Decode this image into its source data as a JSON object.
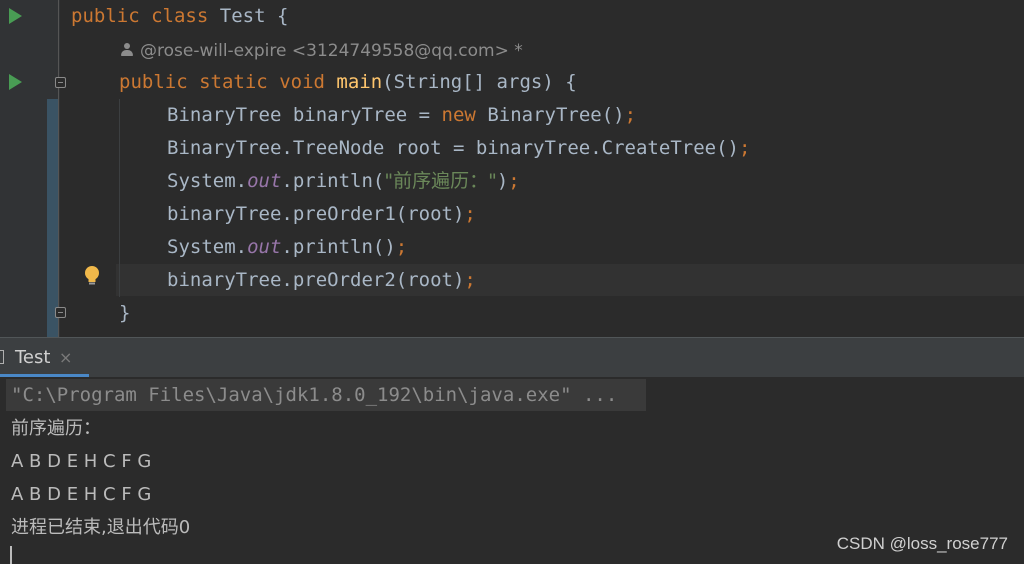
{
  "editor": {
    "line1": {
      "kw1": "public",
      "kw2": "class",
      "name": "Test",
      "brace": "{"
    },
    "author_hint": "@rose-will-expire <3124749558@qq.com> *",
    "line2": {
      "kw1": "public",
      "kw2": "static",
      "kw3": "void",
      "fn": "main",
      "params": "(String[] args) {"
    },
    "line3": {
      "pre": "BinaryTree binaryTree = ",
      "kw": "new",
      "post": " BinaryTree()",
      "semi": ";"
    },
    "line4": {
      "code": "BinaryTree.TreeNode root = binaryTree.CreateTree()",
      "semi": ";"
    },
    "line5": {
      "pre": "System.",
      "out": "out",
      "mid": ".println(",
      "str": "\"前序遍历：\"",
      "close": ")",
      "semi": ";"
    },
    "line6": {
      "code": "binaryTree.preOrder1(root)",
      "semi": ";"
    },
    "line7": {
      "pre": "System.",
      "out": "out",
      "mid": ".println()",
      "semi": ";"
    },
    "line8": {
      "code": "binaryTree.preOrder2(root)",
      "semi": ";"
    },
    "line9": {
      "brace": "}"
    }
  },
  "gutter_icons": [
    "run-icon",
    "run-icon",
    "fold-icon",
    "fold-icon",
    "bulb-icon"
  ],
  "run_panel": {
    "tab_label": "Test",
    "close_glyph": "×"
  },
  "console": {
    "command": "\"C:\\Program Files\\Java\\jdk1.8.0_192\\bin\\java.exe\" ...",
    "lines": [
      "前序遍历：",
      "A B D E H C F G",
      "A B D E H C F G",
      "进程已结束,退出代码0"
    ]
  },
  "watermark": "CSDN @loss_rose777",
  "colors": {
    "background": "#2b2b2b",
    "keyword": "#cc7832",
    "function": "#ffc66d",
    "string": "#6a8759",
    "static_field": "#9876aa",
    "run_green": "#499c54",
    "tab_accent": "#4a88c7"
  }
}
